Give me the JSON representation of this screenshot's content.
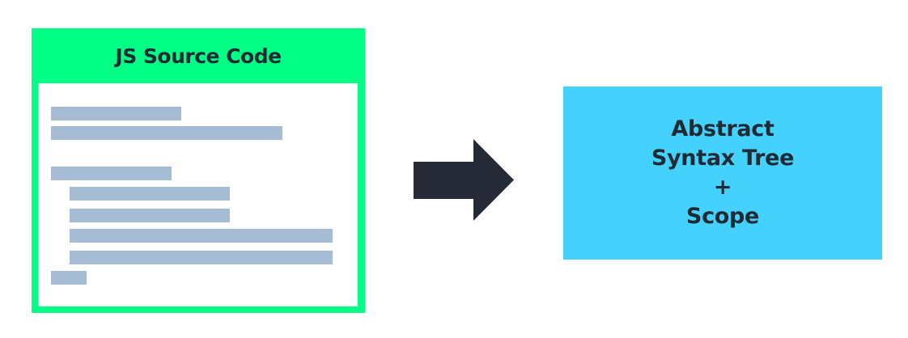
{
  "source": {
    "title": "JS Source Code",
    "box_color": "#02ff85",
    "code_line_color": "#a6bbd4",
    "code_lines": [
      {
        "indent": 0,
        "length": 0.46
      },
      {
        "indent": 0,
        "length": 0.82
      },
      {
        "indent": 0,
        "length": 0.43
      },
      {
        "indent": 1,
        "length": 0.57
      },
      {
        "indent": 1,
        "length": 0.57
      },
      {
        "indent": 1,
        "length": 0.93
      },
      {
        "indent": 1,
        "length": 0.93
      },
      {
        "indent": 0,
        "length": 0.13
      }
    ]
  },
  "arrow": {
    "icon": "right-arrow-icon",
    "color": "#262a36"
  },
  "ast": {
    "box_color": "#44d1fb",
    "lines": [
      "Abstract",
      "Syntax Tree",
      "+",
      "Scope"
    ]
  }
}
